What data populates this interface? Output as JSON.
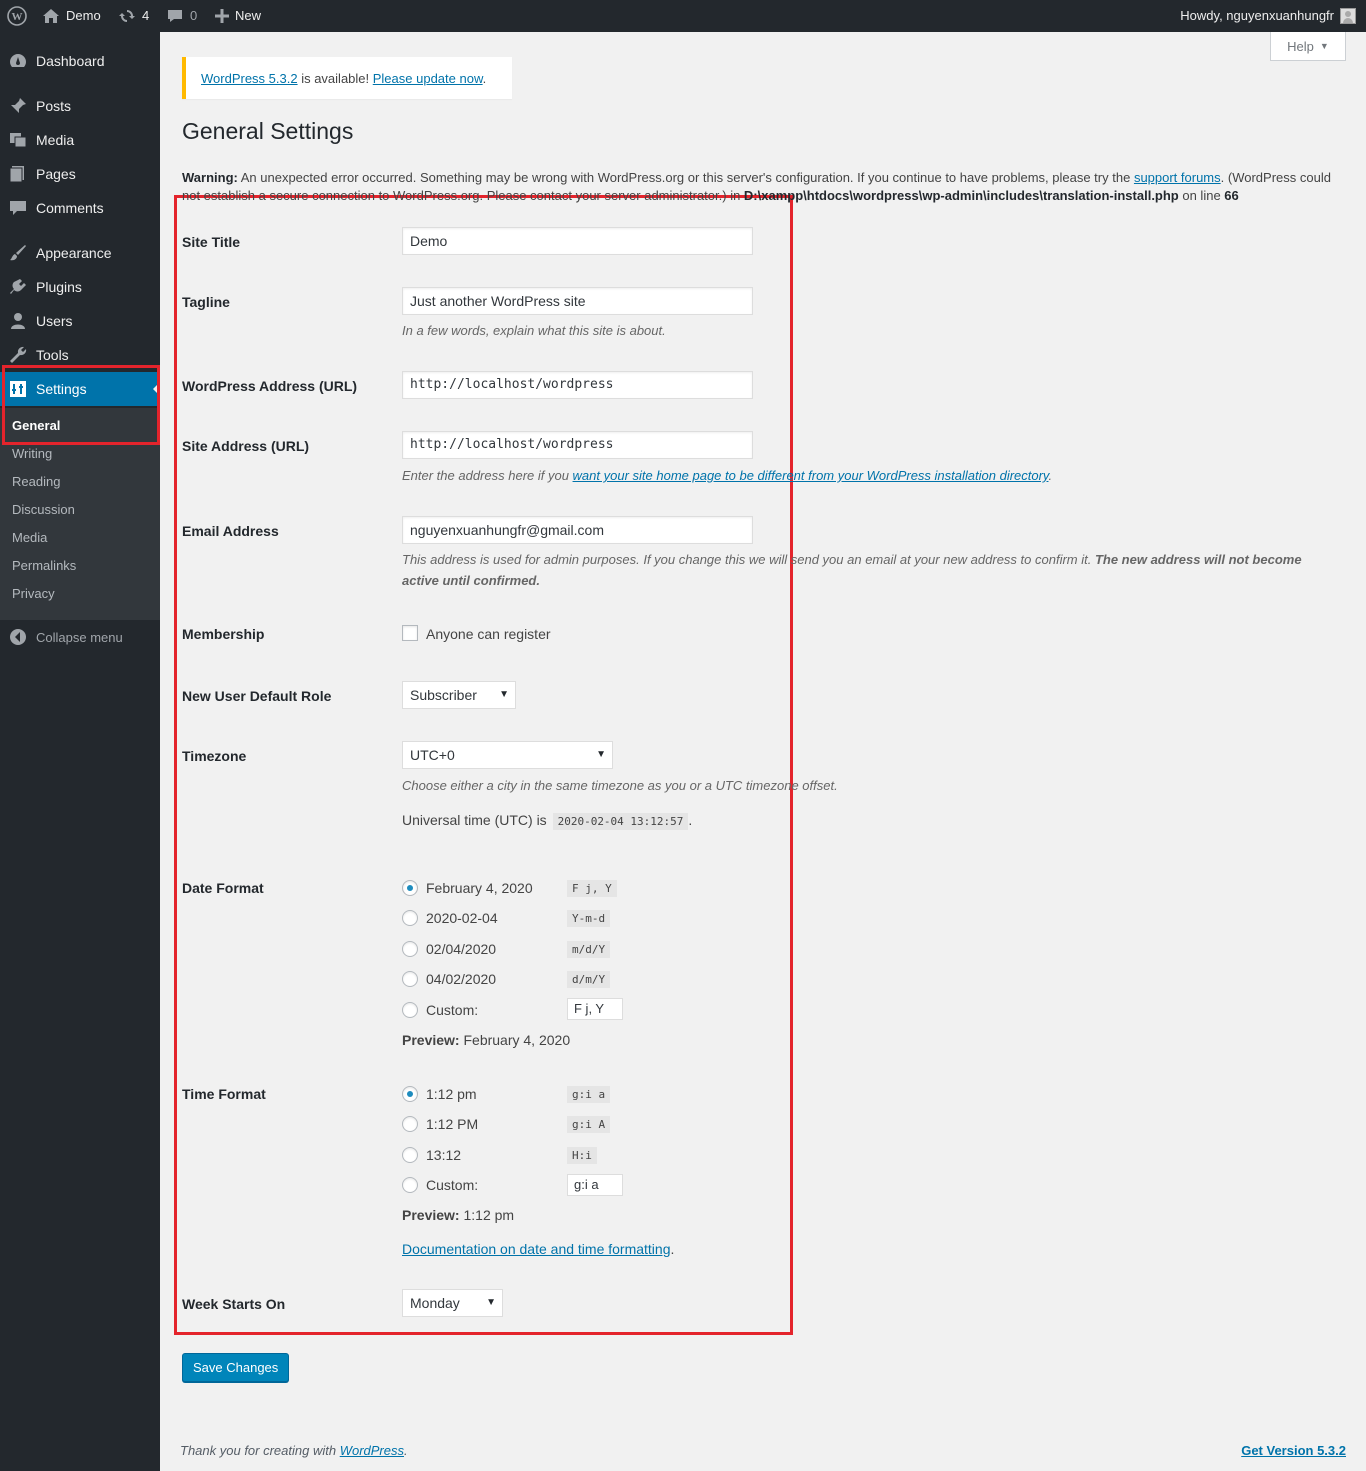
{
  "adminbar": {
    "site_name": "Demo",
    "updates_count": "4",
    "comments_count": "0",
    "new_label": "New",
    "greeting": "Howdy, nguyenxuanhungfr"
  },
  "menu": {
    "items": [
      {
        "label": "Dashboard",
        "icon": "dashboard-icon"
      },
      {
        "label": "Posts",
        "icon": "pin-icon"
      },
      {
        "label": "Media",
        "icon": "media-icon"
      },
      {
        "label": "Pages",
        "icon": "pages-icon"
      },
      {
        "label": "Comments",
        "icon": "comment-icon"
      },
      {
        "label": "Appearance",
        "icon": "brush-icon"
      },
      {
        "label": "Plugins",
        "icon": "plugin-icon"
      },
      {
        "label": "Users",
        "icon": "user-icon"
      },
      {
        "label": "Tools",
        "icon": "wrench-icon"
      },
      {
        "label": "Settings",
        "icon": "settings-icon"
      }
    ],
    "submenu": [
      "General",
      "Writing",
      "Reading",
      "Discussion",
      "Media",
      "Permalinks",
      "Privacy"
    ],
    "collapse": "Collapse menu"
  },
  "help": "Help",
  "notice": {
    "version_link": "WordPress 5.3.2",
    "middle": " is available! ",
    "update_link": "Please update now",
    "end": "."
  },
  "page_title": "General Settings",
  "warning": {
    "strong": "Warning:",
    "text1": " An unexpected error occurred. Something may be wrong with WordPress.org or this server's configuration. If you continue to have problems, please try the ",
    "link": "support forums",
    "text2": ". (WordPress could not establish a secure connection to WordPress.org. Please contact your server administrator.) in ",
    "path": "D:\\xampp\\htdocs\\wordpress\\wp-admin\\includes\\translation-install.php",
    "online": " on line ",
    "line": "66"
  },
  "form": {
    "site_title": {
      "label": "Site Title",
      "value": "Demo"
    },
    "tagline": {
      "label": "Tagline",
      "value": "Just another WordPress site",
      "desc": "In a few words, explain what this site is about."
    },
    "wp_address": {
      "label": "WordPress Address (URL)",
      "value": "http://localhost/wordpress"
    },
    "site_address": {
      "label": "Site Address (URL)",
      "value": "http://localhost/wordpress",
      "desc_pre": "Enter the address here if you ",
      "desc_link": "want your site home page to be different from your WordPress installation directory",
      "desc_post": "."
    },
    "email": {
      "label": "Email Address",
      "value": "nguyenxuanhungfr@gmail.com",
      "desc": "This address is used for admin purposes. If you change this we will send you an email at your new address to confirm it. ",
      "desc_strong": "The new address will not become active until confirmed."
    },
    "membership": {
      "label": "Membership",
      "checkbox_label": "Anyone can register"
    },
    "default_role": {
      "label": "New User Default Role",
      "value": "Subscriber"
    },
    "timezone": {
      "label": "Timezone",
      "value": "UTC+0",
      "desc": "Choose either a city in the same timezone as you or a UTC timezone offset.",
      "utc_label": "Universal time (UTC) is",
      "utc_value": "2020-02-04 13:12:57",
      "utc_end": "."
    },
    "date_format": {
      "label": "Date Format",
      "options": [
        {
          "label": "February 4, 2020",
          "code": "F j, Y"
        },
        {
          "label": "2020-02-04",
          "code": "Y-m-d"
        },
        {
          "label": "02/04/2020",
          "code": "m/d/Y"
        },
        {
          "label": "04/02/2020",
          "code": "d/m/Y"
        }
      ],
      "custom_label": "Custom:",
      "custom_value": "F j, Y",
      "preview_label": "Preview:",
      "preview_value": " February 4, 2020"
    },
    "time_format": {
      "label": "Time Format",
      "options": [
        {
          "label": "1:12 pm",
          "code": "g:i a"
        },
        {
          "label": "1:12 PM",
          "code": "g:i A"
        },
        {
          "label": "13:12",
          "code": "H:i"
        }
      ],
      "custom_label": "Custom:",
      "custom_value": "g:i a",
      "preview_label": "Preview:",
      "preview_value": " 1:12 pm",
      "doc_link": "Documentation on date and time formatting",
      "doc_end": "."
    },
    "week_start": {
      "label": "Week Starts On",
      "value": "Monday"
    }
  },
  "save_button": "Save Changes",
  "footer": {
    "text": "Thank you for creating with ",
    "link": "WordPress",
    "end": ".",
    "version": "Get Version 5.3.2"
  },
  "colors": {
    "accent": "#0073aa",
    "highlight": "#e4242c",
    "notice": "#ffb900"
  }
}
